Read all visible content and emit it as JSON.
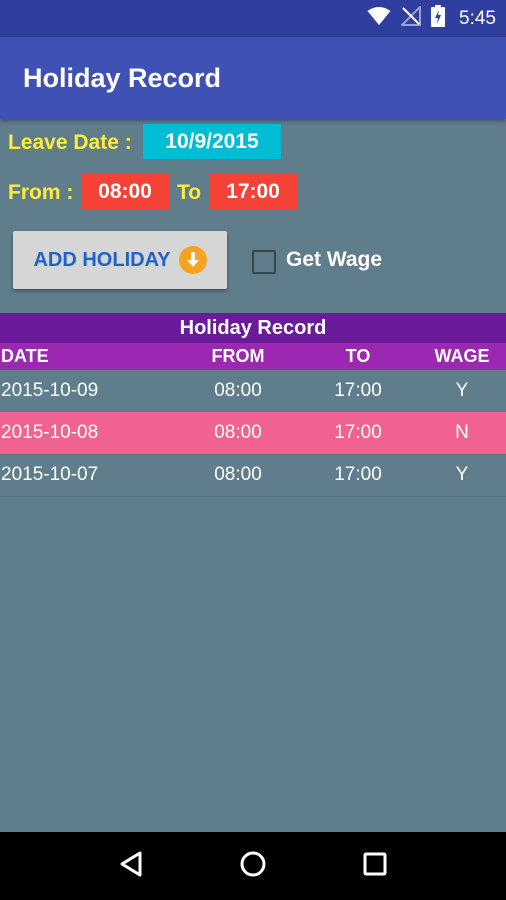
{
  "status_bar": {
    "time": "5:45",
    "icons": [
      "wifi-icon",
      "no-signal-icon",
      "battery-charging-icon"
    ]
  },
  "app_bar": {
    "title": "Holiday Record"
  },
  "form": {
    "leave_date_label": "Leave Date :",
    "leave_date_value": "10/9/2015",
    "from_label": "From :",
    "from_value": "08:00",
    "to_label": "To",
    "to_value": "17:00",
    "add_button_label": "ADD HOLIDAY",
    "get_wage_label": "Get Wage",
    "get_wage_checked": false
  },
  "table": {
    "title": "Holiday Record",
    "headers": [
      "DATE",
      "FROM",
      "TO",
      "WAGE"
    ],
    "rows": [
      {
        "date": "2015-10-09",
        "from": "08:00",
        "to": "17:00",
        "wage": "Y",
        "highlighted": false
      },
      {
        "date": "2015-10-08",
        "from": "08:00",
        "to": "17:00",
        "wage": "N",
        "highlighted": true
      },
      {
        "date": "2015-10-07",
        "from": "08:00",
        "to": "17:00",
        "wage": "Y",
        "highlighted": false
      }
    ]
  },
  "nav_bar": {
    "buttons": [
      "back-icon",
      "home-icon",
      "recents-icon"
    ]
  },
  "colors": {
    "app_bar": "#3f51b5",
    "status_bar": "#303f9f",
    "background": "#607d8b",
    "label_yellow": "#ffeb3b",
    "date_chip": "#00bcd4",
    "time_chip": "#f44336",
    "table_title": "#6a1b9a",
    "table_header": "#9c27b0",
    "row_highlight": "#f06292"
  }
}
